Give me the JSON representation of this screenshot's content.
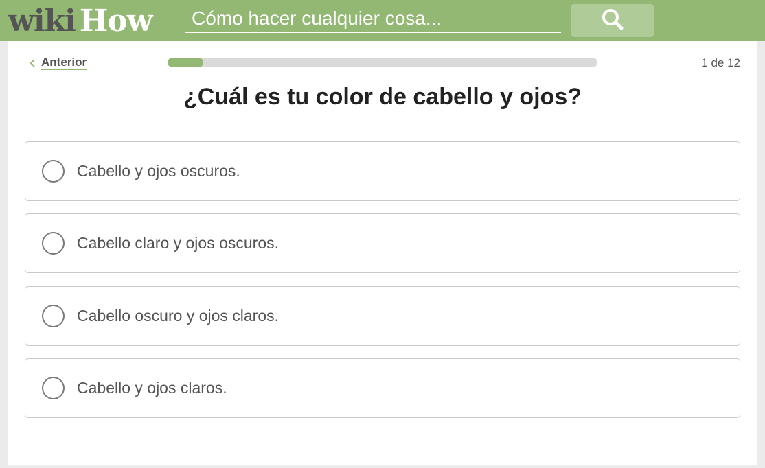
{
  "header": {
    "logo_wiki": "wiki",
    "logo_how": "How",
    "search_placeholder": "Cómo hacer cualquier cosa...",
    "search_icon": "search-icon",
    "colors": {
      "bar": "#93b874",
      "button": "#afcb97"
    }
  },
  "quiz": {
    "prev_label": "Anterior",
    "prev_icon": "chevron-left-icon",
    "progress_fraction": 0.0833,
    "page_count": "1 de 12",
    "question": "¿Cuál es tu color de cabello y ojos?",
    "options": [
      {
        "label": "Cabello y ojos oscuros."
      },
      {
        "label": "Cabello claro y ojos oscuros."
      },
      {
        "label": "Cabello oscuro y ojos claros."
      },
      {
        "label": "Cabello y ojos claros."
      }
    ]
  }
}
